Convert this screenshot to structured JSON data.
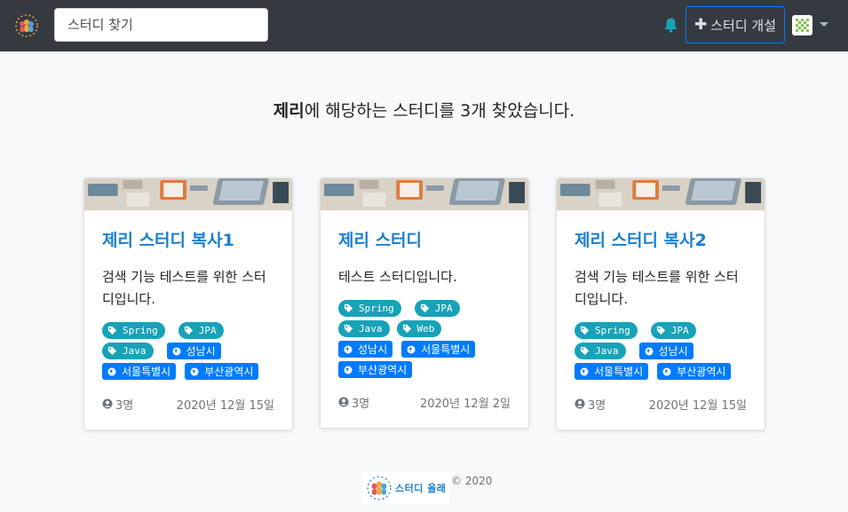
{
  "navbar": {
    "search_placeholder": "스터디 찾기",
    "create_label": "스터디 개설"
  },
  "heading": {
    "keyword": "제리",
    "suffix": "에 해당하는 스터디를 3개 찾았습니다."
  },
  "cards": [
    {
      "title": "제리 스터디 복사1",
      "description": "검색 기능 테스트를 위한 스터디입니다.",
      "tags": [
        "Spring",
        "JPA",
        "Java"
      ],
      "zones": [
        "성남시",
        "서울특별시",
        "부산광역시"
      ],
      "members": "3명",
      "date": "2020년 12월 15일"
    },
    {
      "title": "제리 스터디",
      "description": "테스트 스터디입니다.",
      "tags": [
        "Spring",
        "JPA",
        "Java",
        "Web"
      ],
      "zones": [
        "성남시",
        "서울특별시",
        "부산광역시"
      ],
      "members": "3명",
      "date": "2020년 12월 2일"
    },
    {
      "title": "제리 스터디 복사2",
      "description": "검색 기능 테스트를 위한 스터디입니다.",
      "tags": [
        "Spring",
        "JPA",
        "Java"
      ],
      "zones": [
        "성남시",
        "서울특별시",
        "부산광역시"
      ],
      "members": "3명",
      "date": "2020년 12월 15일"
    }
  ],
  "footer": {
    "logo_text": "스터디 올래",
    "copyright": "© 2020"
  },
  "colors": {
    "navbar": "#343a40",
    "title": "#1a7fd0",
    "tag": "#17a2b8",
    "zone": "#007bff",
    "bell": "#17a2b8"
  },
  "icons": {
    "logo": "people-circle-logo",
    "bell": "bell-icon",
    "plus": "plus-icon",
    "tag": "tag-icon",
    "zone": "globe-icon",
    "members": "user-circle-icon"
  }
}
